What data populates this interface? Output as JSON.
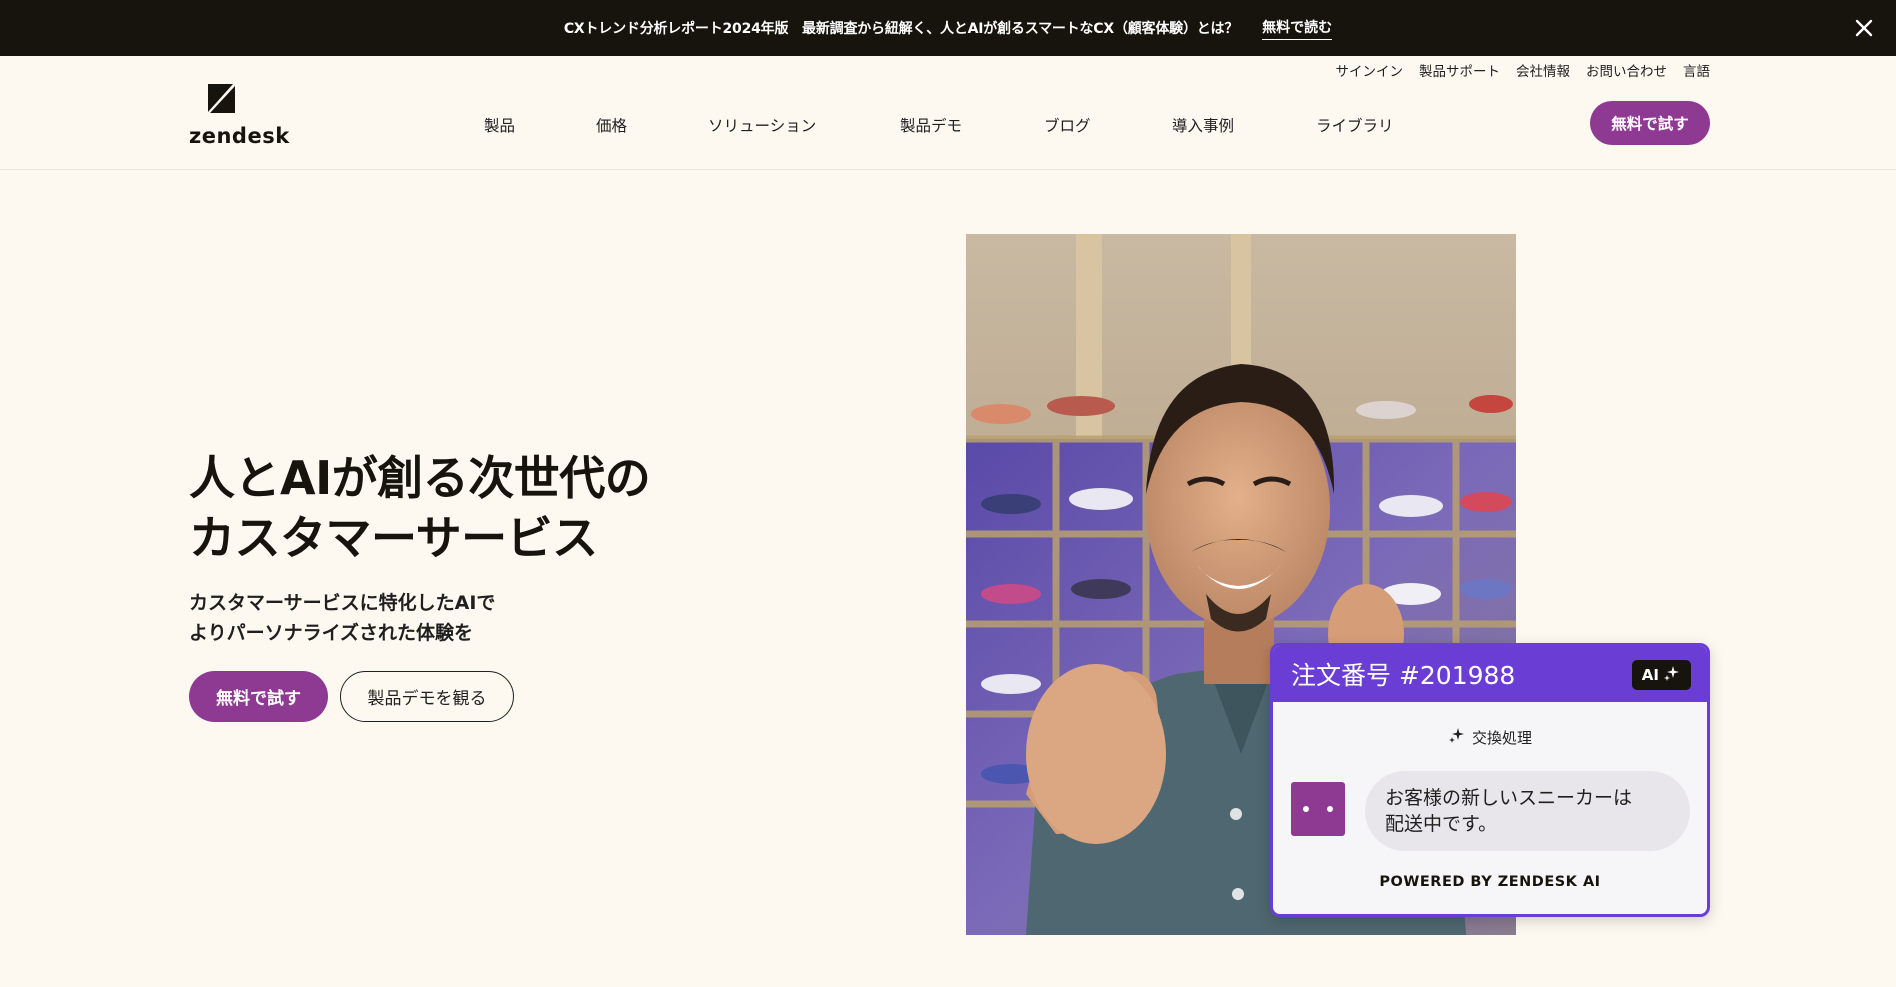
{
  "announcement": {
    "message": "CXトレンド分析レポート2024年版　最新調査から紐解く、人とAIが創るスマートなCX（顧客体験）とは？",
    "link_label": "無料で読む"
  },
  "brand": {
    "name": "zendesk"
  },
  "utility_nav": [
    "サインイン",
    "製品サポート",
    "会社情報",
    "お問い合わせ",
    "言語"
  ],
  "main_nav": [
    "製品",
    "価格",
    "ソリューション",
    "製品デモ",
    "ブログ",
    "導入事例",
    "ライブラリ"
  ],
  "header_cta": "無料で試す",
  "hero": {
    "title_line1": "人とAIが創る次世代の",
    "title_line2": "カスタマーサービス",
    "subtitle_line1": "カスタマーサービスに特化したAIで",
    "subtitle_line2": "よりパーソナライズされた体験を",
    "primary_cta": "無料で試す",
    "secondary_cta": "製品デモを観る"
  },
  "ai_card": {
    "order_title": "注文番号 #201988",
    "badge": "AI",
    "action": "交換処理",
    "message_line1": "お客様の新しいスニーカーは",
    "message_line2": "配送中です。",
    "powered_by": "POWERED BY ZENDESK AI"
  },
  "colors": {
    "brand_purple": "#8e3a93",
    "ai_violet": "#6a3ed4",
    "announcement_bg": "#16140c",
    "page_bg": "#fdf9f1"
  }
}
